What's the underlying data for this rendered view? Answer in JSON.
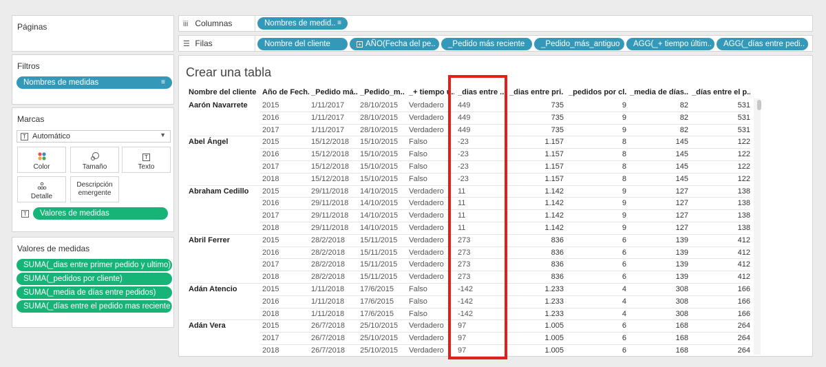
{
  "left": {
    "pages_title": "Páginas",
    "filters_title": "Filtros",
    "filter_pill": "Nombres de medidas",
    "marks_title": "Marcas",
    "marks_type": "Automático",
    "cards": {
      "color": "Color",
      "size": "Tamaño",
      "text": "Texto",
      "detail": "Detalle",
      "tooltip_line1": "Descripción",
      "tooltip_line2": "emergente"
    },
    "marks_pill": "Valores de medidas",
    "values_title": "Valores de medidas",
    "values_pills": [
      "SUMA(_dias entre primer pedido y ultimo)",
      "SUMA(_pedidos por cliente)",
      "SUMA(_media de días entre pedidos)",
      "SUMA(_días entre el pedido mas reciente)"
    ]
  },
  "shelves": {
    "columns_label": "Columnas",
    "columns_pills": [
      "Nombres de medid.."
    ],
    "rows_label": "Filas",
    "rows_pills": [
      "Nombre del cliente",
      "AÑO(Fecha del pe..",
      "_Pedido más reciente",
      "_Pedido_más_antiguo",
      "AGG(_+ tiempo últim..",
      "AGG(_días entre pedi.."
    ]
  },
  "sheet": {
    "title": "Crear una tabla",
    "headers": [
      "Nombre del cliente",
      "Año de Fech..",
      "_Pedido má..",
      "_Pedido_m..",
      "_+ tiempo ú..",
      "_dias entre ..",
      "_dias entre pri..",
      "_pedidos por cl..",
      "_media de días..",
      "_días entre el p.."
    ],
    "rows": [
      [
        "Aarón Navarrete",
        "2015",
        "1/11/2017",
        "28/10/2015",
        "Verdadero",
        "449",
        "735",
        "9",
        "82",
        "531"
      ],
      [
        "",
        "2016",
        "1/11/2017",
        "28/10/2015",
        "Verdadero",
        "449",
        "735",
        "9",
        "82",
        "531"
      ],
      [
        "",
        "2017",
        "1/11/2017",
        "28/10/2015",
        "Verdadero",
        "449",
        "735",
        "9",
        "82",
        "531"
      ],
      [
        "Abel Ángel",
        "2015",
        "15/12/2018",
        "15/10/2015",
        "Falso",
        "-23",
        "1.157",
        "8",
        "145",
        "122"
      ],
      [
        "",
        "2016",
        "15/12/2018",
        "15/10/2015",
        "Falso",
        "-23",
        "1.157",
        "8",
        "145",
        "122"
      ],
      [
        "",
        "2017",
        "15/12/2018",
        "15/10/2015",
        "Falso",
        "-23",
        "1.157",
        "8",
        "145",
        "122"
      ],
      [
        "",
        "2018",
        "15/12/2018",
        "15/10/2015",
        "Falso",
        "-23",
        "1.157",
        "8",
        "145",
        "122"
      ],
      [
        "Abraham Cedillo",
        "2015",
        "29/11/2018",
        "14/10/2015",
        "Verdadero",
        "11",
        "1.142",
        "9",
        "127",
        "138"
      ],
      [
        "",
        "2016",
        "29/11/2018",
        "14/10/2015",
        "Verdadero",
        "11",
        "1.142",
        "9",
        "127",
        "138"
      ],
      [
        "",
        "2017",
        "29/11/2018",
        "14/10/2015",
        "Verdadero",
        "11",
        "1.142",
        "9",
        "127",
        "138"
      ],
      [
        "",
        "2018",
        "29/11/2018",
        "14/10/2015",
        "Verdadero",
        "11",
        "1.142",
        "9",
        "127",
        "138"
      ],
      [
        "Abril Ferrer",
        "2015",
        "28/2/2018",
        "15/11/2015",
        "Verdadero",
        "273",
        "836",
        "6",
        "139",
        "412"
      ],
      [
        "",
        "2016",
        "28/2/2018",
        "15/11/2015",
        "Verdadero",
        "273",
        "836",
        "6",
        "139",
        "412"
      ],
      [
        "",
        "2017",
        "28/2/2018",
        "15/11/2015",
        "Verdadero",
        "273",
        "836",
        "6",
        "139",
        "412"
      ],
      [
        "",
        "2018",
        "28/2/2018",
        "15/11/2015",
        "Verdadero",
        "273",
        "836",
        "6",
        "139",
        "412"
      ],
      [
        "Adán Atencio",
        "2015",
        "1/11/2018",
        "17/6/2015",
        "Falso",
        "-142",
        "1.233",
        "4",
        "308",
        "166"
      ],
      [
        "",
        "2016",
        "1/11/2018",
        "17/6/2015",
        "Falso",
        "-142",
        "1.233",
        "4",
        "308",
        "166"
      ],
      [
        "",
        "2018",
        "1/11/2018",
        "17/6/2015",
        "Falso",
        "-142",
        "1.233",
        "4",
        "308",
        "166"
      ],
      [
        "Adán Vera",
        "2015",
        "26/7/2018",
        "25/10/2015",
        "Verdadero",
        "97",
        "1.005",
        "6",
        "168",
        "264"
      ],
      [
        "",
        "2017",
        "26/7/2018",
        "25/10/2015",
        "Verdadero",
        "97",
        "1.005",
        "6",
        "168",
        "264"
      ],
      [
        "",
        "2018",
        "26/7/2018",
        "25/10/2015",
        "Verdadero",
        "97",
        "1.005",
        "6",
        "168",
        "264"
      ]
    ],
    "highlight_color": "#e0201d"
  }
}
